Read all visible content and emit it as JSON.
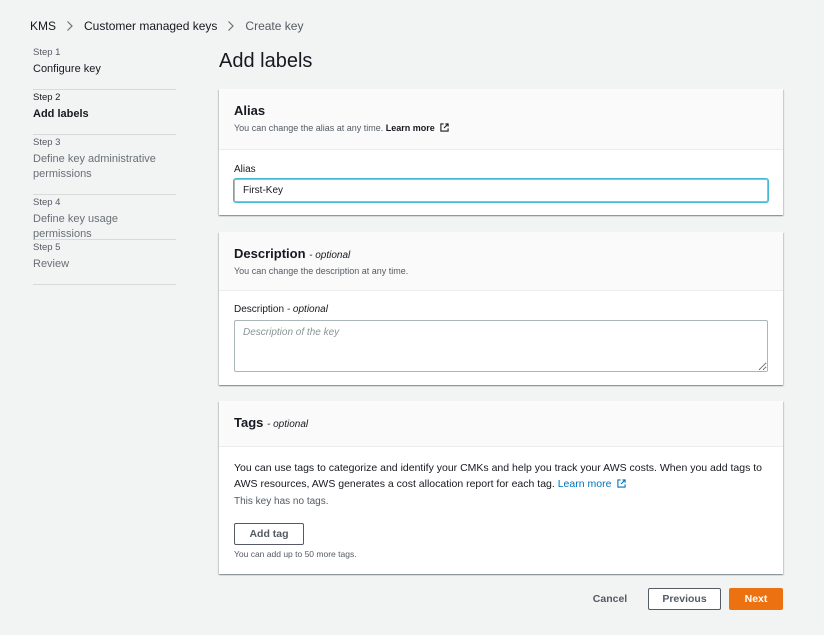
{
  "breadcrumb": {
    "items": [
      "KMS",
      "Customer managed keys"
    ],
    "current": "Create key"
  },
  "steps": [
    {
      "num": "Step 1",
      "title": "Configure key",
      "state": "done"
    },
    {
      "num": "Step 2",
      "title": "Add labels",
      "state": "active"
    },
    {
      "num": "Step 3",
      "title": "Define key administrative permissions",
      "state": "future"
    },
    {
      "num": "Step 4",
      "title": "Define key usage permissions",
      "state": "future"
    },
    {
      "num": "Step 5",
      "title": "Review",
      "state": "future"
    }
  ],
  "page_title": "Add labels",
  "alias": {
    "title": "Alias",
    "description": "You can change the alias at any time.",
    "learn_more": "Learn more",
    "field_label": "Alias",
    "value": "First-Key"
  },
  "description": {
    "title": "Description",
    "optional": "- optional",
    "description": "You can change the description at any time.",
    "field_label": "Description",
    "placeholder": "Description of the key",
    "value": ""
  },
  "tags": {
    "title": "Tags",
    "optional": "- optional",
    "text": "You can use tags to categorize and identify your CMKs and help you track your AWS costs. When you add tags to AWS resources, AWS generates a cost allocation report for each tag.",
    "learn_more": "Learn more",
    "empty": "This key has no tags.",
    "add_label": "Add tag",
    "limit": "You can add up to 50 more tags."
  },
  "footer": {
    "cancel": "Cancel",
    "previous": "Previous",
    "next": "Next"
  },
  "colors": {
    "primary": "#ec7211",
    "link": "#0073bb",
    "focus": "#44b9d6",
    "background": "#f2f3f3"
  },
  "icons": {
    "separator": "chevron-right-icon",
    "external": "external-link-icon"
  }
}
